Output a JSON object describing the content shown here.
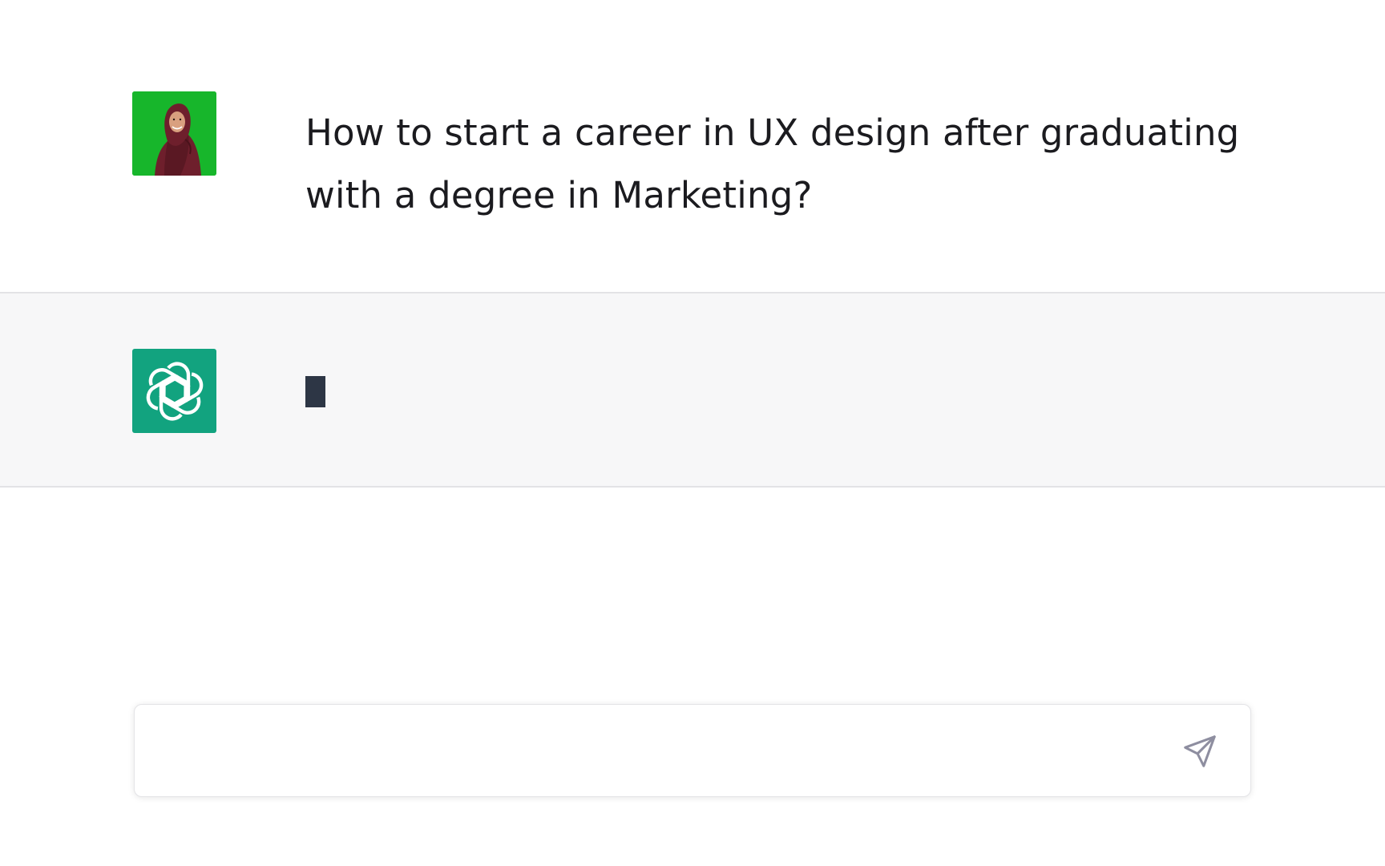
{
  "conversation": {
    "user_message": {
      "avatar": "user-avatar-photo",
      "text": "How to start a career in UX design after graduating with a degree in Marketing?"
    },
    "assistant_message": {
      "avatar": "openai-logo-icon",
      "text": "",
      "state": "typing-cursor"
    }
  },
  "composer": {
    "value": "",
    "placeholder": "",
    "send_icon": "paper-plane-icon"
  },
  "colors": {
    "user_avatar_bg": "#17b62b",
    "assistant_avatar_bg": "#12a37f",
    "assistant_row_bg": "#f7f7f8",
    "cursor": "#2d3645",
    "send_icon": "#8e8ea0"
  }
}
